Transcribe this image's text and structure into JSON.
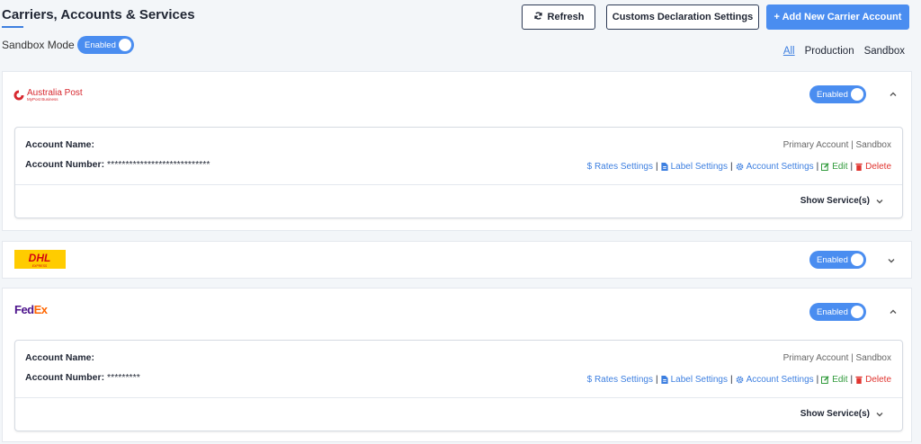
{
  "header": {
    "title": "Carriers, Accounts & Services",
    "refresh_label": "Refresh",
    "customs_label": "Customs Declaration Settings",
    "add_label": "+ Add New Carrier Account"
  },
  "sandbox": {
    "label": "Sandbox Mode",
    "toggle_label": "Enabled"
  },
  "filters": {
    "all": "All",
    "production": "Production",
    "sandbox": "Sandbox"
  },
  "carriers": [
    {
      "name": "Australia Post",
      "logo_text": "Australia Post",
      "logo_sub": "MyPost Business",
      "toggle_label": "Enabled",
      "account": {
        "name_label": "Account Name:",
        "number_label": "Account Number:",
        "number_value": "****************************",
        "meta": "Primary Account | Sandbox",
        "rates": "$ Rates Settings",
        "label": "Label Settings",
        "account_settings": "Account Settings",
        "edit": "Edit",
        "delete": "Delete",
        "show_services": "Show Service(s)"
      }
    },
    {
      "name": "DHL",
      "logo_text": "DHL",
      "logo_sub": "EXPRESS",
      "toggle_label": "Enabled"
    },
    {
      "name": "FedEx",
      "logo_fe": "Fed",
      "logo_ex": "Ex",
      "toggle_label": "Enabled",
      "account": {
        "name_label": "Account Name:",
        "number_label": "Account Number:",
        "number_value": "*********",
        "meta": "Primary Account | Sandbox",
        "rates": "$ Rates Settings",
        "label": "Label Settings",
        "account_settings": "Account Settings",
        "edit": "Edit",
        "delete": "Delete",
        "show_services": "Show Service(s)"
      }
    }
  ],
  "separator": "|",
  "colors": {
    "accent": "#4a8df0",
    "link": "#3d7fe0",
    "edit": "#2f9a3a",
    "delete": "#e0342f"
  }
}
